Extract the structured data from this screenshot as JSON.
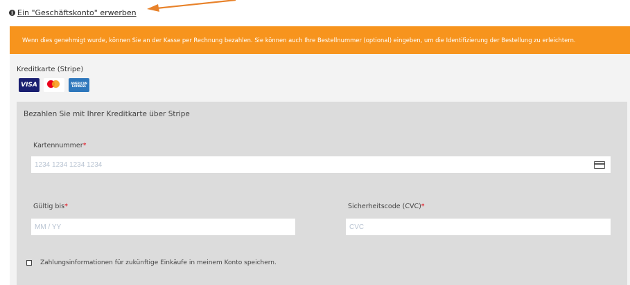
{
  "top_link": {
    "label": "Ein \"Geschäftskonto\" erwerben",
    "icon": "info-icon"
  },
  "accent_color": "#f7941d",
  "banner": {
    "text": "Wenn dies genehmigt wurde, können Sie an der Kasse per Rechnung bezahlen. Sie können auch Ihre Bestellnummer (optional) eingeben, um die Identifizierung der Bestellung zu erleichtern."
  },
  "payment": {
    "title": "Kreditkarte (Stripe)",
    "cards": {
      "visa": "VISA",
      "amex": "AMERICAN EXPRESS"
    },
    "stripe_title": "Bezahlen Sie mit Ihrer Kreditkarte über Stripe",
    "card_number": {
      "label": "Kartennummer",
      "required": "*",
      "placeholder": "1234 1234 1234 1234"
    },
    "expiry": {
      "label": "Gültig bis",
      "required": "*",
      "placeholder": "MM / YY"
    },
    "cvc": {
      "label": "Sicherheitscode (CVC)",
      "required": "*",
      "placeholder": "CVC"
    },
    "save_label": "Zahlungsinformationen für zukünftige Einkäufe in meinem Konto speichern."
  }
}
